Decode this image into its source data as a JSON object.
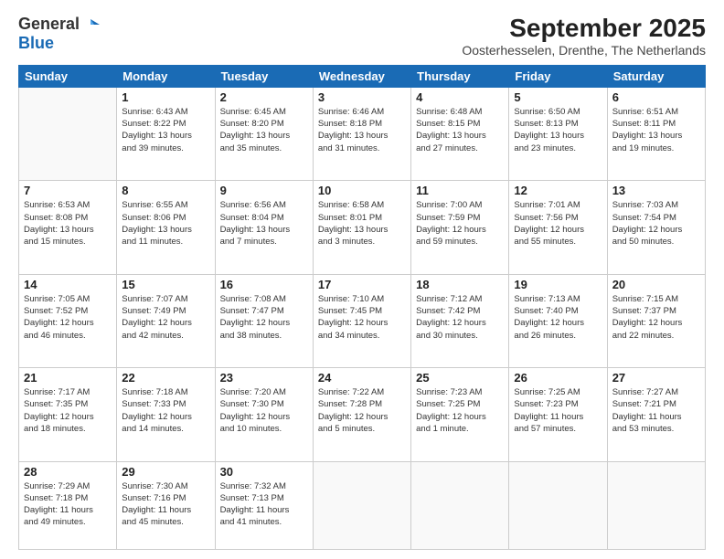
{
  "header": {
    "logo_general": "General",
    "logo_blue": "Blue",
    "month": "September 2025",
    "location": "Oosterhesselen, Drenthe, The Netherlands"
  },
  "weekdays": [
    "Sunday",
    "Monday",
    "Tuesday",
    "Wednesday",
    "Thursday",
    "Friday",
    "Saturday"
  ],
  "weeks": [
    [
      {
        "day": "",
        "info": ""
      },
      {
        "day": "1",
        "info": "Sunrise: 6:43 AM\nSunset: 8:22 PM\nDaylight: 13 hours\nand 39 minutes."
      },
      {
        "day": "2",
        "info": "Sunrise: 6:45 AM\nSunset: 8:20 PM\nDaylight: 13 hours\nand 35 minutes."
      },
      {
        "day": "3",
        "info": "Sunrise: 6:46 AM\nSunset: 8:18 PM\nDaylight: 13 hours\nand 31 minutes."
      },
      {
        "day": "4",
        "info": "Sunrise: 6:48 AM\nSunset: 8:15 PM\nDaylight: 13 hours\nand 27 minutes."
      },
      {
        "day": "5",
        "info": "Sunrise: 6:50 AM\nSunset: 8:13 PM\nDaylight: 13 hours\nand 23 minutes."
      },
      {
        "day": "6",
        "info": "Sunrise: 6:51 AM\nSunset: 8:11 PM\nDaylight: 13 hours\nand 19 minutes."
      }
    ],
    [
      {
        "day": "7",
        "info": "Sunrise: 6:53 AM\nSunset: 8:08 PM\nDaylight: 13 hours\nand 15 minutes."
      },
      {
        "day": "8",
        "info": "Sunrise: 6:55 AM\nSunset: 8:06 PM\nDaylight: 13 hours\nand 11 minutes."
      },
      {
        "day": "9",
        "info": "Sunrise: 6:56 AM\nSunset: 8:04 PM\nDaylight: 13 hours\nand 7 minutes."
      },
      {
        "day": "10",
        "info": "Sunrise: 6:58 AM\nSunset: 8:01 PM\nDaylight: 13 hours\nand 3 minutes."
      },
      {
        "day": "11",
        "info": "Sunrise: 7:00 AM\nSunset: 7:59 PM\nDaylight: 12 hours\nand 59 minutes."
      },
      {
        "day": "12",
        "info": "Sunrise: 7:01 AM\nSunset: 7:56 PM\nDaylight: 12 hours\nand 55 minutes."
      },
      {
        "day": "13",
        "info": "Sunrise: 7:03 AM\nSunset: 7:54 PM\nDaylight: 12 hours\nand 50 minutes."
      }
    ],
    [
      {
        "day": "14",
        "info": "Sunrise: 7:05 AM\nSunset: 7:52 PM\nDaylight: 12 hours\nand 46 minutes."
      },
      {
        "day": "15",
        "info": "Sunrise: 7:07 AM\nSunset: 7:49 PM\nDaylight: 12 hours\nand 42 minutes."
      },
      {
        "day": "16",
        "info": "Sunrise: 7:08 AM\nSunset: 7:47 PM\nDaylight: 12 hours\nand 38 minutes."
      },
      {
        "day": "17",
        "info": "Sunrise: 7:10 AM\nSunset: 7:45 PM\nDaylight: 12 hours\nand 34 minutes."
      },
      {
        "day": "18",
        "info": "Sunrise: 7:12 AM\nSunset: 7:42 PM\nDaylight: 12 hours\nand 30 minutes."
      },
      {
        "day": "19",
        "info": "Sunrise: 7:13 AM\nSunset: 7:40 PM\nDaylight: 12 hours\nand 26 minutes."
      },
      {
        "day": "20",
        "info": "Sunrise: 7:15 AM\nSunset: 7:37 PM\nDaylight: 12 hours\nand 22 minutes."
      }
    ],
    [
      {
        "day": "21",
        "info": "Sunrise: 7:17 AM\nSunset: 7:35 PM\nDaylight: 12 hours\nand 18 minutes."
      },
      {
        "day": "22",
        "info": "Sunrise: 7:18 AM\nSunset: 7:33 PM\nDaylight: 12 hours\nand 14 minutes."
      },
      {
        "day": "23",
        "info": "Sunrise: 7:20 AM\nSunset: 7:30 PM\nDaylight: 12 hours\nand 10 minutes."
      },
      {
        "day": "24",
        "info": "Sunrise: 7:22 AM\nSunset: 7:28 PM\nDaylight: 12 hours\nand 5 minutes."
      },
      {
        "day": "25",
        "info": "Sunrise: 7:23 AM\nSunset: 7:25 PM\nDaylight: 12 hours\nand 1 minute."
      },
      {
        "day": "26",
        "info": "Sunrise: 7:25 AM\nSunset: 7:23 PM\nDaylight: 11 hours\nand 57 minutes."
      },
      {
        "day": "27",
        "info": "Sunrise: 7:27 AM\nSunset: 7:21 PM\nDaylight: 11 hours\nand 53 minutes."
      }
    ],
    [
      {
        "day": "28",
        "info": "Sunrise: 7:29 AM\nSunset: 7:18 PM\nDaylight: 11 hours\nand 49 minutes."
      },
      {
        "day": "29",
        "info": "Sunrise: 7:30 AM\nSunset: 7:16 PM\nDaylight: 11 hours\nand 45 minutes."
      },
      {
        "day": "30",
        "info": "Sunrise: 7:32 AM\nSunset: 7:13 PM\nDaylight: 11 hours\nand 41 minutes."
      },
      {
        "day": "",
        "info": ""
      },
      {
        "day": "",
        "info": ""
      },
      {
        "day": "",
        "info": ""
      },
      {
        "day": "",
        "info": ""
      }
    ]
  ]
}
